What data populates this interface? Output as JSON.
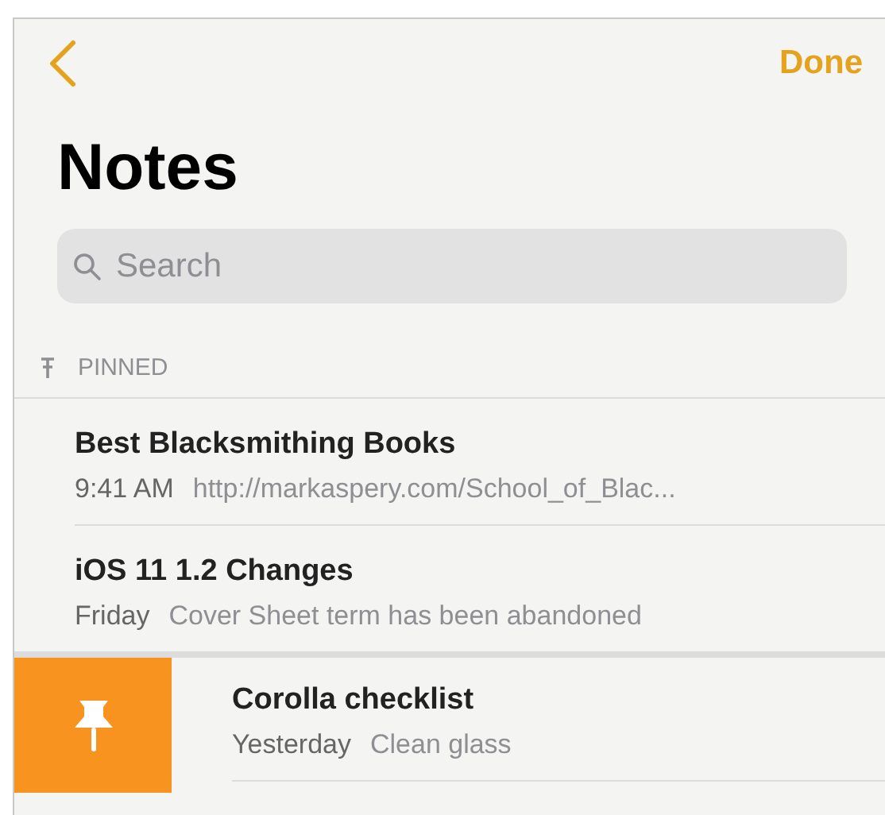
{
  "nav": {
    "done": "Done"
  },
  "title": "Notes",
  "search": {
    "placeholder": "Search"
  },
  "sections": [
    {
      "header": "PINNED",
      "notes": [
        {
          "title": "Best Blacksmithing Books",
          "date": "9:41 AM",
          "preview": "http://markaspery.com/School_of_Blac...",
          "swiped": false
        },
        {
          "title": "iOS 11 1.2 Changes",
          "date": "Friday",
          "preview": "Cover Sheet term has been abandoned",
          "swiped": false
        }
      ]
    },
    {
      "notes": [
        {
          "title": "Corolla checklist",
          "date": "Yesterday",
          "preview": "Clean glass",
          "swiped": true
        }
      ]
    }
  ]
}
